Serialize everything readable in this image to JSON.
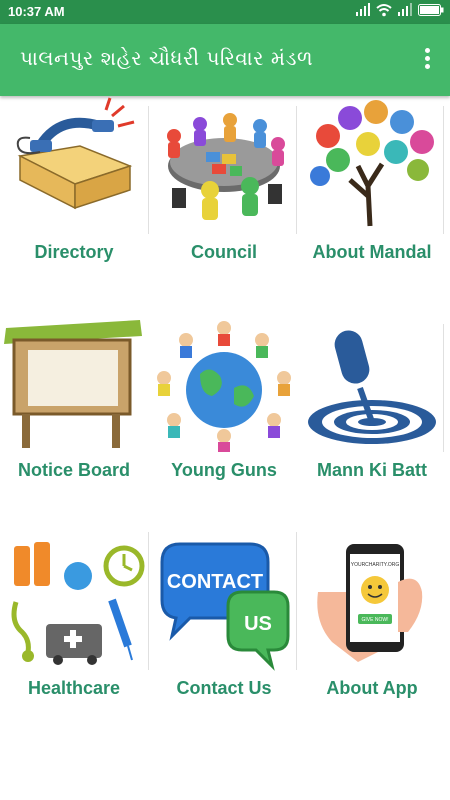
{
  "status": {
    "time": "10:37 AM"
  },
  "appbar": {
    "title": "પાલનપુર શહેર ચૌધરી પરિવાર મંડળ"
  },
  "tiles": [
    {
      "label": "Directory"
    },
    {
      "label": "Council"
    },
    {
      "label": "About Mandal"
    },
    {
      "label": "Notice Board"
    },
    {
      "label": "Young Guns"
    },
    {
      "label": "Mann Ki Batt"
    },
    {
      "label": "Healthcare"
    },
    {
      "label": "Contact Us"
    },
    {
      "label": "About App"
    }
  ],
  "contact_art": {
    "word1": "CONTACT",
    "word2": "US"
  },
  "phone_art": {
    "site": "YOURCHARITY.ORG",
    "button": "GIVE NOW!"
  },
  "colors": {
    "statusbar": "#2a8f4c",
    "appbar": "#44b86a",
    "label": "#2a8f6a"
  }
}
